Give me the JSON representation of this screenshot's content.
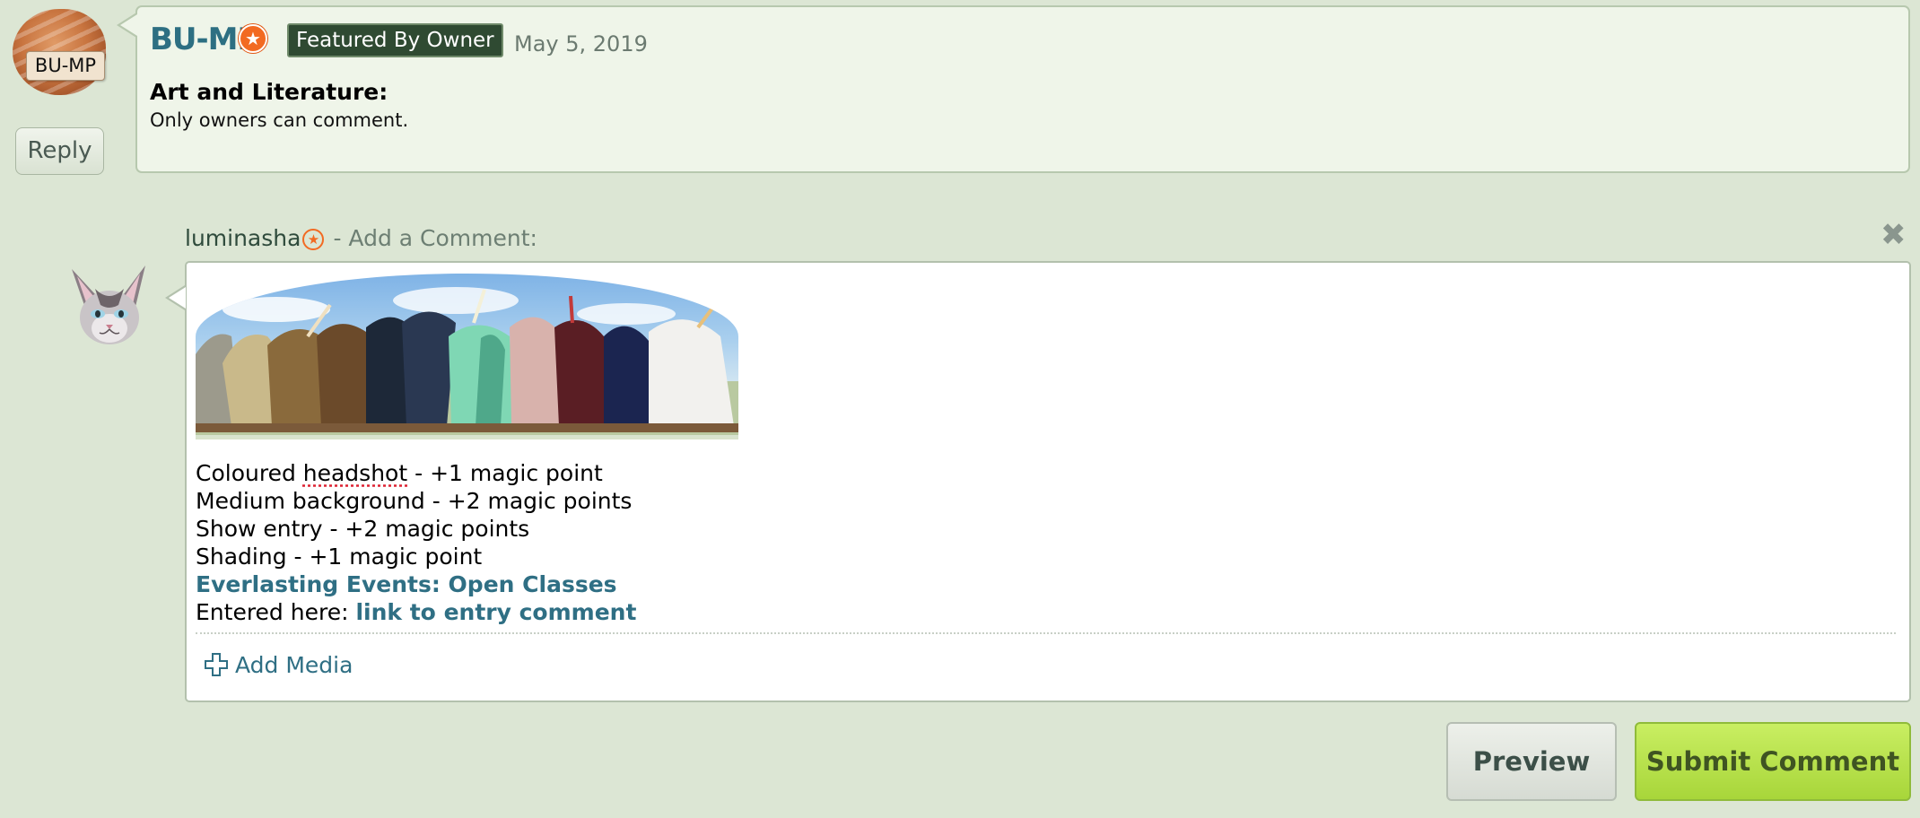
{
  "colors": {
    "page_bg": "#dce6d4",
    "accent_link": "#2f6f84",
    "star_orange": "#f26a22",
    "submit_green": "#a8d63a"
  },
  "comment": {
    "avatar_label": "BU-MP",
    "username": "BU-MP",
    "badge": "Featured By Owner",
    "date": "May 5, 2019",
    "title": "Art and Literature:",
    "body": "Only owners can comment.",
    "reply_label": "Reply"
  },
  "reply_form": {
    "username": "luminasha",
    "header_suffix": "- Add a Comment:",
    "close_icon": "close-icon",
    "lines": {
      "line1_prefix": "Coloured ",
      "line1_misspelled": "headshot",
      "line1_suffix": " - +1 magic point",
      "line2": "Medium background - +2 magic points",
      "line3": "Show entry - +2 magic points",
      "line4": "Shading - +1 magic point",
      "event_link": "Everlasting Events: Open Classes",
      "entered_prefix": "Entered here: ",
      "entry_link": "link to entry comment"
    },
    "add_media_label": "Add Media",
    "preview_label": "Preview",
    "submit_label": "Submit Comment"
  }
}
